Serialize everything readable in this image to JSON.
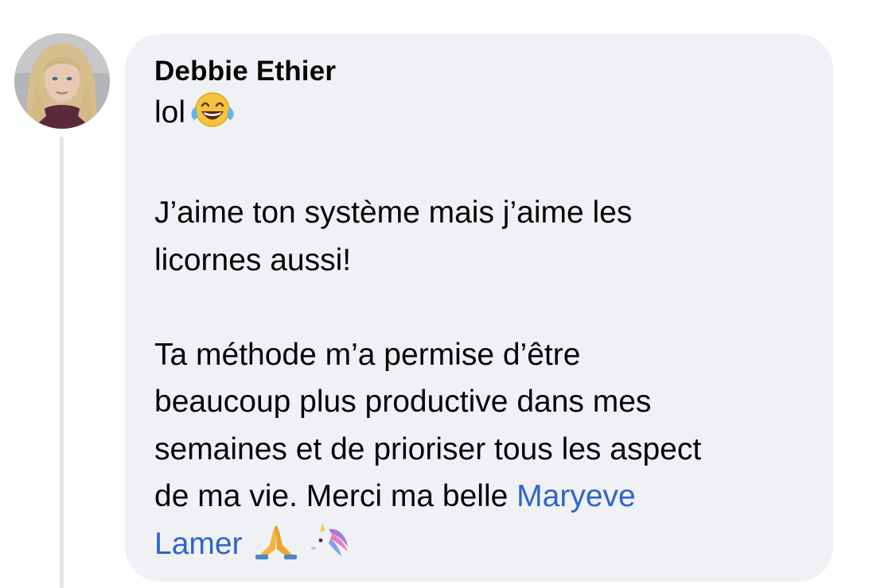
{
  "comment": {
    "author": "Debbie Ethier",
    "lines": {
      "p1": "lol",
      "p2_l1": "J’aime ton système mais j’aime les",
      "p2_l2": "licornes aussi!",
      "p3_l1": "Ta méthode m’a permise d’être",
      "p3_l2": "beaucoup plus productive dans mes",
      "p3_l3": "semaines et de prioriser tous les aspect",
      "p3_l4": "de ma vie. Merci ma belle "
    },
    "mention": {
      "first": "Maryeve",
      "last": "Lamer"
    },
    "emojis": [
      "face-with-tears-of-joy-icon",
      "folded-hands-icon",
      "unicorn-icon"
    ]
  },
  "colors": {
    "bubble": "#f0f1f5",
    "text": "#050505",
    "mention": "#2f65c9",
    "thread_line": "#e4e5ea"
  }
}
